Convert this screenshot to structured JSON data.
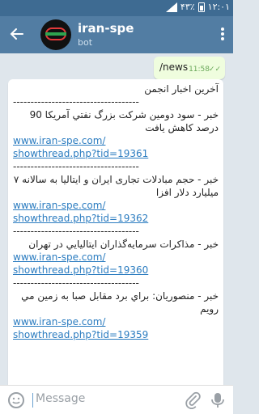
{
  "status_bar": {
    "battery_text": "۴۳٪",
    "time": "۱۲:۰۱"
  },
  "header": {
    "title": "iran-spe",
    "subtitle": "bot"
  },
  "outgoing": {
    "text": "/news",
    "time": "11:58"
  },
  "incoming": {
    "lines": [
      {
        "type": "text",
        "text": "آخرین اخبار انجمن"
      },
      {
        "type": "sep",
        "text": "------------------------------------"
      },
      {
        "type": "text",
        "text": "خبر - سود دومین شرکت بزرگ نفتي آمریکا 90 درصد کاهش یافت"
      },
      {
        "type": "link",
        "text": "www.iran-spe.com/\nshowthread.php?tid=19361"
      },
      {
        "type": "sep",
        "text": "------------------------------------"
      },
      {
        "type": "text",
        "text": "خبر - حجم مبادلات تجاری ایران و ایتالیا به سالانه ۷ میلیارد دلار افزا"
      },
      {
        "type": "link",
        "text": "www.iran-spe.com/\nshowthread.php?tid=19362"
      },
      {
        "type": "sep",
        "text": "------------------------------------"
      },
      {
        "type": "text",
        "text": "خبر - مذاکرات سرمایه‌گذاران ایتالیایي در تهران"
      },
      {
        "type": "link",
        "text": "www.iran-spe.com/\nshowthread.php?tid=19360"
      },
      {
        "type": "sep",
        "text": "------------------------------------"
      },
      {
        "type": "text",
        "text": "خبر - منصوریان: براي برد مقابل صبا به زمین مي رویم"
      },
      {
        "type": "link",
        "text": "www.iran-spe.com/\nshowthread.php?tid=19359"
      }
    ]
  },
  "input": {
    "placeholder": "Message"
  },
  "icons": {
    "back": "arrow-left-icon",
    "menu": "more-vert-icon",
    "emoji": "emoji-icon",
    "attach": "paperclip-icon",
    "mic": "microphone-icon",
    "read": "double-check-icon"
  },
  "colors": {
    "header": "#527da3",
    "statusbar": "#3e6b92",
    "link": "#2b7cc0",
    "outgoing_bubble": "#effdde"
  }
}
